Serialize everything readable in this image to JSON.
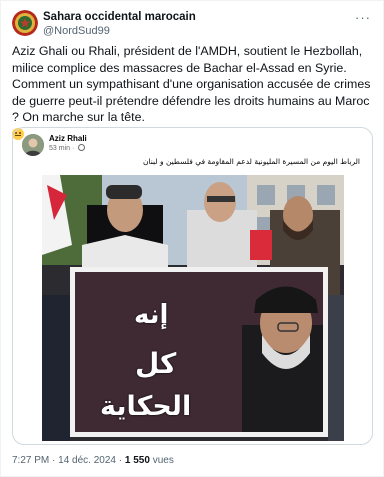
{
  "author": {
    "display_name": "Sahara occidental marocain",
    "handle": "@NordSud99"
  },
  "tweet": {
    "text": "Aziz Ghali ou Rhali, président de l'AMDH, soutient le Hezbollah, milice complice des massacres de Bachar el-Assad en Syrie. Comment un sympathisant d'une organisation accusée de crimes de guerre peut-il prétendre défendre les droits humains au Maroc ? On marche sur la tête.",
    "emoji": "neutral-face-emoji"
  },
  "quoted_post": {
    "author_name": "Aziz Rhali",
    "time": "53 min",
    "text": "الرباط اليوم من المسيرة المليونية لدعم المقاومة في فلسطين و لبنان",
    "banner_lines": [
      "إنه",
      "كل",
      "الحكاية"
    ]
  },
  "footer": {
    "time": "7:27 PM",
    "date": "14 déc. 2024",
    "views_count": "1 550",
    "views_label": "vues",
    "separator": "·"
  },
  "icons": {
    "more": "more-options-icon",
    "globe": "globe-icon"
  },
  "colors": {
    "secondary_text": "#536471",
    "border": "#cfd9de"
  }
}
